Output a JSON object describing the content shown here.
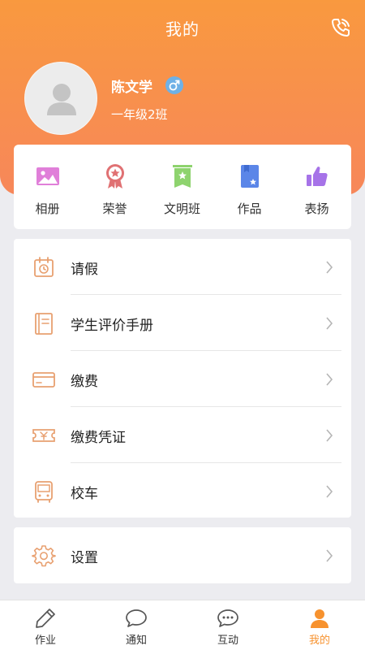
{
  "header": {
    "title": "我的",
    "phone_icon": "phone-icon"
  },
  "profile": {
    "name": "陈文学",
    "gender_icon": "male-icon",
    "class": "一年级2班"
  },
  "quick_actions": [
    {
      "label": "相册",
      "icon": "album-icon",
      "color": "#e07fd9"
    },
    {
      "label": "荣誉",
      "icon": "honor-medal-icon",
      "color": "#e07173"
    },
    {
      "label": "文明班",
      "icon": "civilized-class-flag-icon",
      "color": "#8ed36e"
    },
    {
      "label": "作品",
      "icon": "works-book-icon",
      "color": "#5b86e8"
    },
    {
      "label": "表扬",
      "icon": "thumbs-up-icon",
      "color": "#a673e8"
    }
  ],
  "menu": [
    {
      "label": "请假",
      "icon": "leave-calendar-icon"
    },
    {
      "label": "学生评价手册",
      "icon": "evaluation-handbook-icon"
    },
    {
      "label": "缴费",
      "icon": "payment-card-icon"
    },
    {
      "label": "缴费凭证",
      "icon": "payment-voucher-icon"
    },
    {
      "label": "校车",
      "icon": "school-bus-icon"
    }
  ],
  "settings": {
    "label": "设置",
    "icon": "gear-icon"
  },
  "tabs": [
    {
      "label": "作业",
      "icon": "homework-pencil-icon"
    },
    {
      "label": "通知",
      "icon": "notification-bubble-icon"
    },
    {
      "label": "互动",
      "icon": "interaction-chat-icon"
    },
    {
      "label": "我的",
      "icon": "profile-person-icon",
      "active": true
    }
  ],
  "colors": {
    "header_gradient_start": "#f9993f",
    "header_gradient_end": "#f7875a",
    "accent": "#f7922e",
    "menu_icon": "#e8a070"
  }
}
